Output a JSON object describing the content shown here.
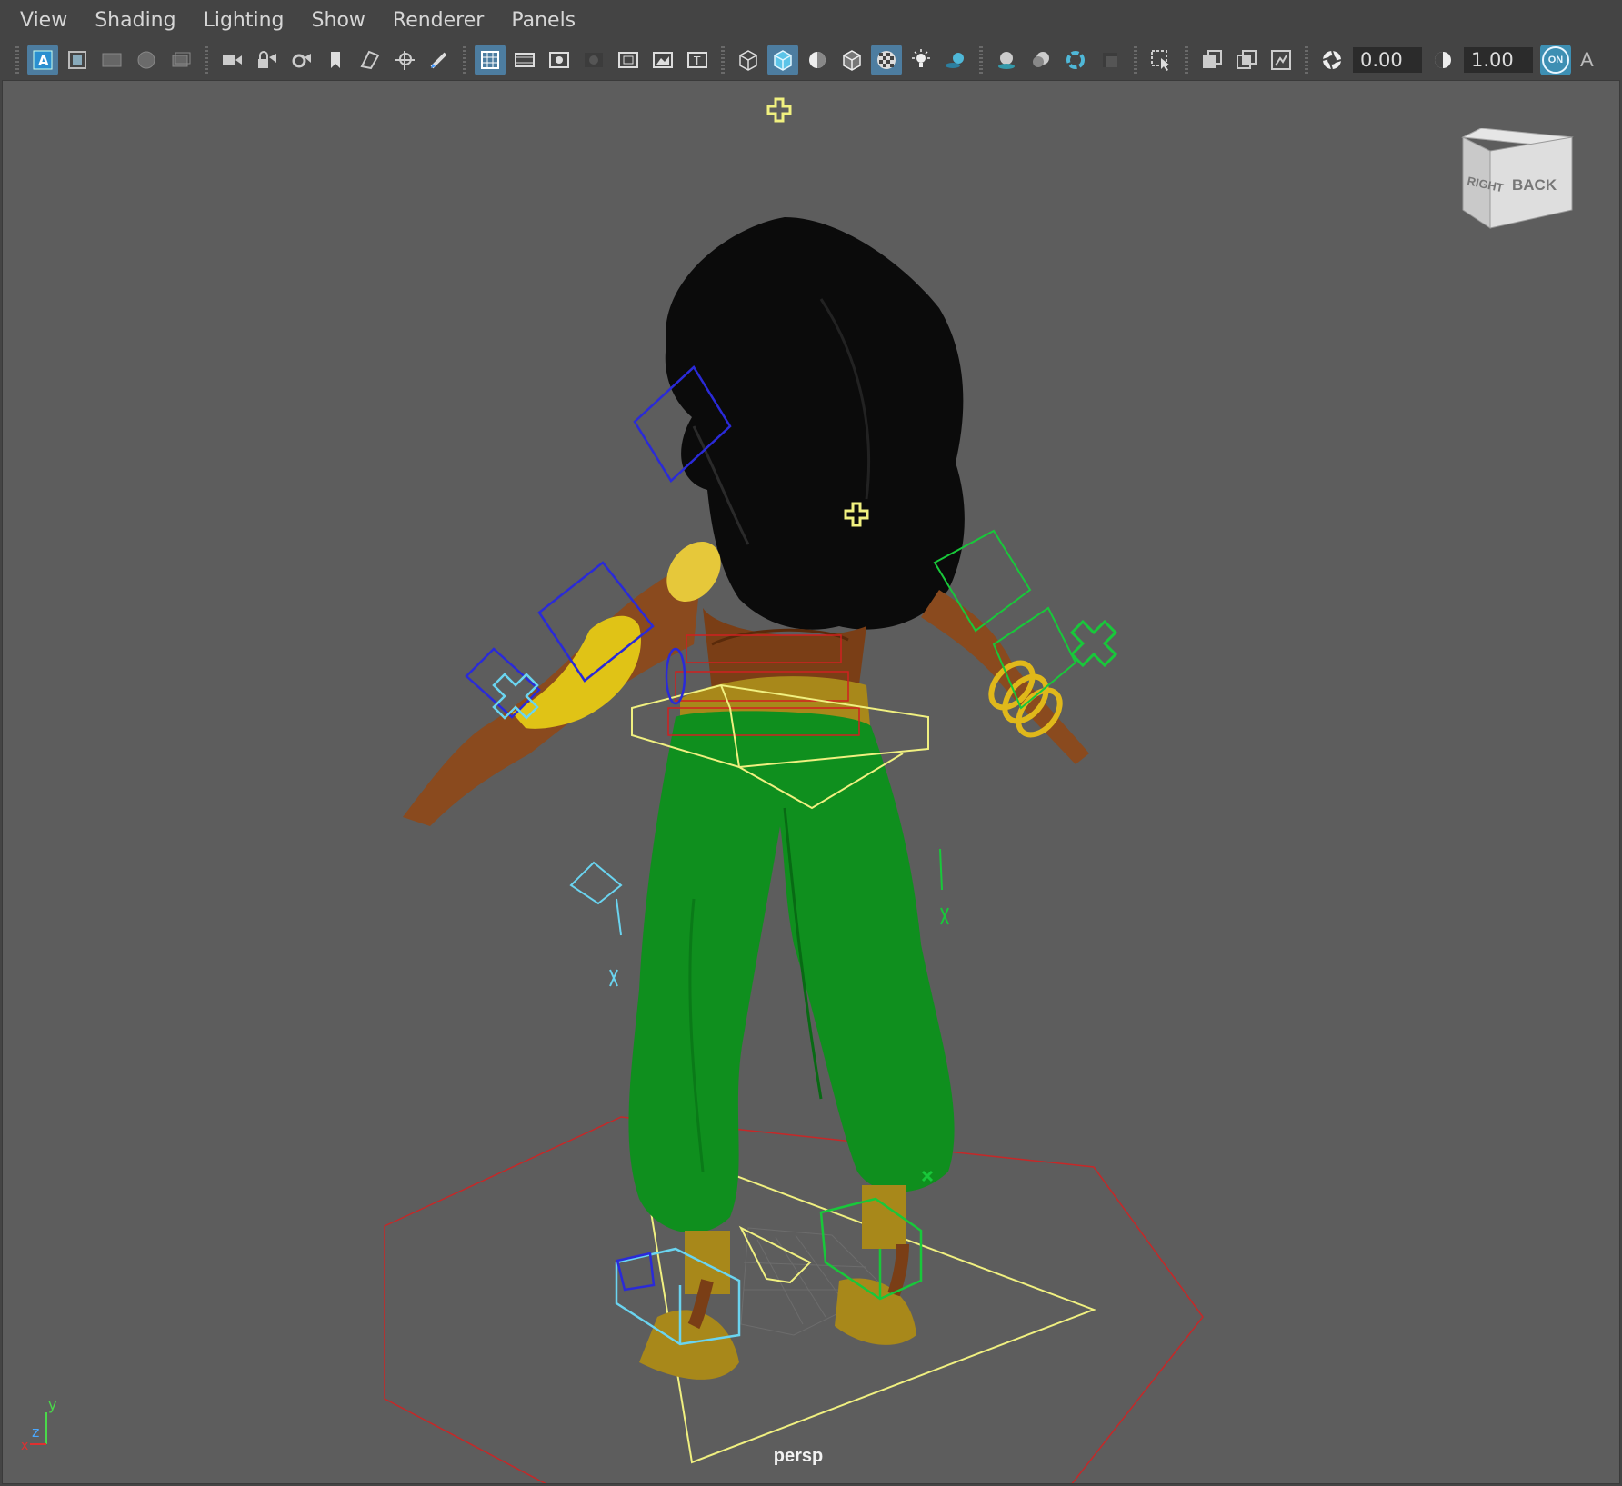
{
  "menu": {
    "items": [
      "View",
      "Shading",
      "Lighting",
      "Show",
      "Renderer",
      "Panels"
    ]
  },
  "toolbar": {
    "exposure_value": "0.00",
    "gamma_value": "1.00",
    "color_management_label": "ON",
    "trailing_label": "A",
    "icons": [
      "select-camera-icon",
      "camera-attributes-icon",
      "bookmarks-icon",
      "image-plane-icon",
      "grid-icon",
      "film-gate-icon",
      "resolution-gate-icon",
      "gate-mask-icon",
      "field-chart-icon",
      "safe-action-icon",
      "safe-title-icon",
      "wireframe-icon",
      "smooth-shade-icon",
      "default-lighting-icon",
      "shadows-icon",
      "textured-icon",
      "lights-icon",
      "isolate-select-icon",
      "xray-icon",
      "xray-joints-icon",
      "backface-icon",
      "exposure-icon",
      "gamma-icon",
      "color-management-icon"
    ]
  },
  "viewport": {
    "camera_label": "persp",
    "viewcube": {
      "left_face": "RIGHT",
      "front_face": "BACK"
    },
    "axis": {
      "x": "x",
      "y": "y",
      "z": "z"
    },
    "colors": {
      "background": "#5d5d5d",
      "hair": "#0b0b0b",
      "skin": "#8a4a1e",
      "pants": "#0f8f1e",
      "gold": "#c9a21a",
      "controls_left": "#2a2ad8",
      "controls_light": "#6ad4f0",
      "controls_right": "#18c83a",
      "controls_center": "#f0f080",
      "controls_spine": "#d02020"
    }
  }
}
